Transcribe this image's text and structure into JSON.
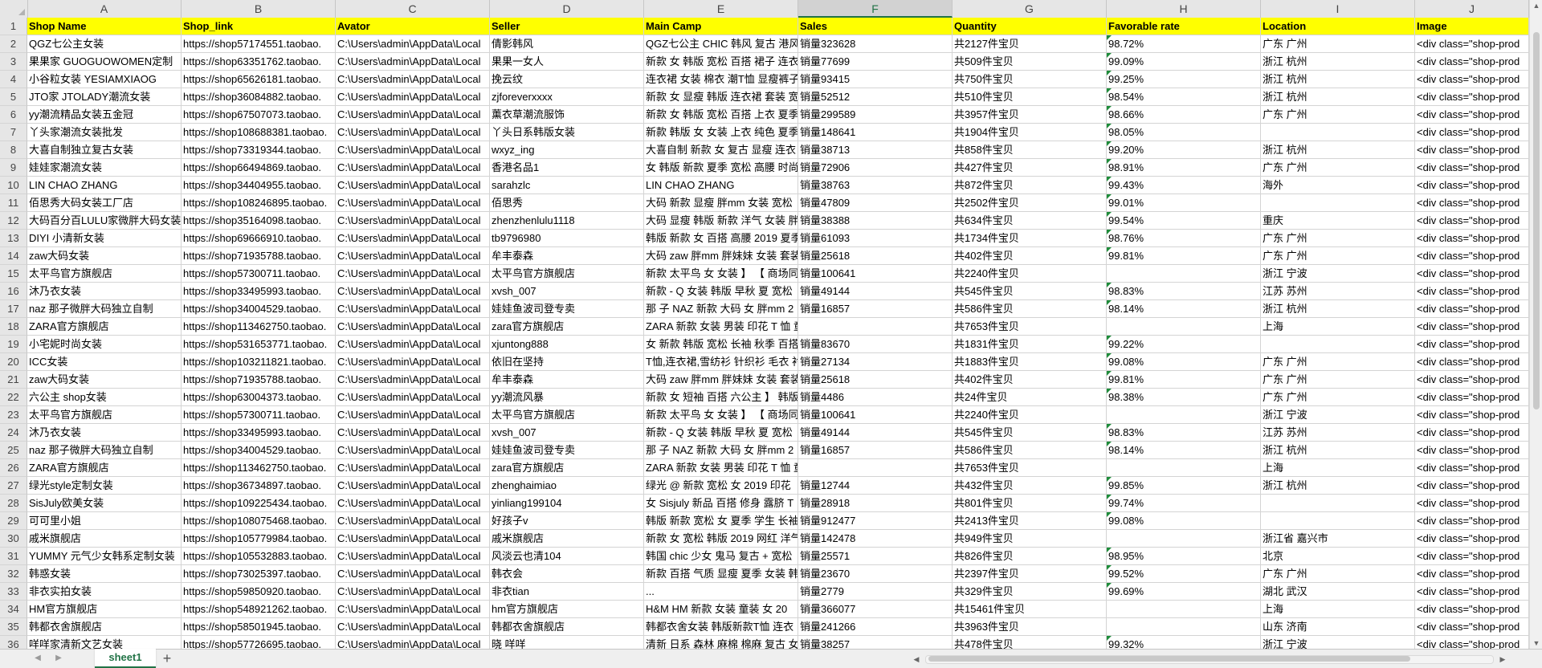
{
  "columns": [
    "A",
    "B",
    "C",
    "D",
    "E",
    "F",
    "G",
    "H",
    "I",
    "J"
  ],
  "selected_column": "F",
  "header_row": [
    "Shop Name",
    "Shop_link",
    "Avator",
    "Seller",
    "Main Camp",
    "Sales",
    "Quantity",
    "Favorable rate",
    "Location",
    "Image"
  ],
  "rows": [
    {
      "num": "2",
      "cells": [
        "QGZ七公主女装",
        "https://shop57174551.taobao.",
        "C:\\Users\\admin\\AppData\\Local",
        "倩影韩风",
        "QGZ七公主 CHIC 韩风 复古 港风",
        "销量323628",
        "共2127件宝贝",
        "98.72%",
        "广东 广州",
        "<div class=\"shop-prod"
      ],
      "flags": [
        false,
        false,
        false,
        false,
        false,
        false,
        false,
        true,
        false,
        false
      ]
    },
    {
      "num": "3",
      "cells": [
        "果果家  GUOGUOWOMEN定制",
        "https://shop63351762.taobao.",
        "C:\\Users\\admin\\AppData\\Local",
        "果果一女人",
        "新款 女 韩版 宽松 百搭 裙子 连衣",
        "销量77699",
        "共509件宝贝",
        "99.09%",
        "浙江 杭州",
        "<div class=\"shop-prod"
      ],
      "flags": [
        false,
        false,
        false,
        false,
        false,
        false,
        false,
        true,
        false,
        false
      ]
    },
    {
      "num": "4",
      "cells": [
        "小谷粒女装 YESIAMXIAOG",
        "https://shop65626181.taobao.",
        "C:\\Users\\admin\\AppData\\Local",
        "挽云纹",
        "连衣裙 女装 棉衣 潮T恤 显瘦裤子",
        "销量93415",
        "共750件宝贝",
        "99.25%",
        "浙江 杭州",
        "<div class=\"shop-prod"
      ],
      "flags": [
        false,
        false,
        false,
        false,
        false,
        false,
        false,
        true,
        false,
        false
      ]
    },
    {
      "num": "5",
      "cells": [
        "JTO家 JTOLADY潮流女装",
        "https://shop36084882.taobao.",
        "C:\\Users\\admin\\AppData\\Local",
        "zjforeverxxxx",
        "新款 女 显瘦 韩版 连衣裙 套装 宽",
        "销量52512",
        "共510件宝贝",
        "98.54%",
        "浙江 杭州",
        "<div class=\"shop-prod"
      ],
      "flags": [
        false,
        false,
        false,
        false,
        false,
        false,
        false,
        true,
        false,
        false
      ]
    },
    {
      "num": "6",
      "cells": [
        "yy潮流精品女装五金冠",
        "https://shop67507073.taobao.",
        "C:\\Users\\admin\\AppData\\Local",
        "薰衣草潮流服饰",
        "新款 女 韩版 宽松 百搭 上衣 夏季",
        "销量299589",
        "共3957件宝贝",
        "98.66%",
        "广东 广州",
        "<div class=\"shop-prod"
      ],
      "flags": [
        false,
        false,
        false,
        false,
        false,
        false,
        false,
        true,
        false,
        false
      ]
    },
    {
      "num": "7",
      "cells": [
        "丫头家潮流女装批发",
        "https://shop108688381.taobao.",
        "C:\\Users\\admin\\AppData\\Local",
        "丫头日系韩版女装",
        "新款 韩版 女 女装 上衣 纯色 夏季",
        "销量148641",
        "共1904件宝贝",
        "98.05%",
        "",
        "<div class=\"shop-prod"
      ],
      "flags": [
        false,
        false,
        false,
        false,
        false,
        false,
        false,
        true,
        false,
        false
      ]
    },
    {
      "num": "8",
      "cells": [
        "大喜自制独立复古女装",
        "https://shop73319344.taobao.",
        "C:\\Users\\admin\\AppData\\Local",
        "wxyz_ing",
        "大喜自制 新款 女 复古 显瘦 连衣",
        "销量38713",
        "共858件宝贝",
        "99.20%",
        "浙江 杭州",
        "<div class=\"shop-prod"
      ],
      "flags": [
        false,
        false,
        false,
        false,
        false,
        false,
        false,
        true,
        false,
        false
      ]
    },
    {
      "num": "9",
      "cells": [
        "娃娃家潮流女装",
        "https://shop66494869.taobao.",
        "C:\\Users\\admin\\AppData\\Local",
        "香港名品1",
        "女 韩版 新款 夏季 宽松 高腰 时尚",
        "销量72906",
        "共427件宝贝",
        "98.91%",
        "广东 广州",
        "<div class=\"shop-prod"
      ],
      "flags": [
        false,
        false,
        false,
        false,
        false,
        false,
        false,
        true,
        false,
        false
      ]
    },
    {
      "num": "10",
      "cells": [
        "LIN CHAO ZHANG",
        "https://shop34404955.taobao.",
        "C:\\Users\\admin\\AppData\\Local",
        "sarahzlc",
        "LIN CHAO ZHANG",
        "销量38763",
        "共872件宝贝",
        "99.43%",
        "海外",
        "<div class=\"shop-prod"
      ],
      "flags": [
        false,
        false,
        false,
        false,
        false,
        false,
        false,
        true,
        false,
        false
      ]
    },
    {
      "num": "11",
      "cells": [
        "佰思秀大码女装工厂店",
        "https://shop108246895.taobao.",
        "C:\\Users\\admin\\AppData\\Local",
        "佰思秀",
        "大码 新款 显瘦 胖mm 女装 宽松",
        "销量47809",
        "共2502件宝贝",
        "99.01%",
        "",
        "<div class=\"shop-prod"
      ],
      "flags": [
        false,
        false,
        false,
        false,
        false,
        false,
        false,
        true,
        false,
        false
      ]
    },
    {
      "num": "12",
      "cells": [
        "大码百分百LULU家微胖大码女装",
        "https://shop35164098.taobao.",
        "C:\\Users\\admin\\AppData\\Local",
        "zhenzhenlulu1118",
        "大码 显瘦 韩版 新款 洋气 女装 胖",
        "销量38388",
        "共634件宝贝",
        "99.54%",
        "重庆",
        "<div class=\"shop-prod"
      ],
      "flags": [
        false,
        false,
        false,
        false,
        false,
        false,
        false,
        true,
        false,
        false
      ]
    },
    {
      "num": "13",
      "cells": [
        "DIYI 小清新女装",
        "https://shop69666910.taobao.",
        "C:\\Users\\admin\\AppData\\Local",
        "tb9796980",
        "韩版 新款 女 百搭 高腰 2019 夏季",
        "销量61093",
        "共1734件宝贝",
        "98.76%",
        "广东 广州",
        "<div class=\"shop-prod"
      ],
      "flags": [
        false,
        false,
        false,
        false,
        false,
        false,
        false,
        true,
        false,
        false
      ]
    },
    {
      "num": "14",
      "cells": [
        "zaw大码女装",
        "https://shop71935788.taobao.",
        "C:\\Users\\admin\\AppData\\Local",
        "牟丰泰森",
        "大码 zaw 胖mm 胖妹妹 女装 套装",
        "销量25618",
        "共402件宝贝",
        "99.81%",
        "广东 广州",
        "<div class=\"shop-prod"
      ],
      "flags": [
        false,
        false,
        false,
        false,
        false,
        false,
        false,
        true,
        false,
        false
      ]
    },
    {
      "num": "15",
      "cells": [
        "太平鸟官方旗舰店",
        "https://shop57300711.taobao.",
        "C:\\Users\\admin\\AppData\\Local",
        "太平鸟官方旗舰店",
        "新款 太平鸟 女 女装 】 【 商场同",
        "销量100641",
        "共2240件宝贝",
        "",
        "浙江 宁波",
        "<div class=\"shop-prod"
      ],
      "flags": [
        false,
        false,
        false,
        false,
        false,
        false,
        false,
        false,
        false,
        false
      ]
    },
    {
      "num": "16",
      "cells": [
        "沐乃衣女装",
        "https://shop33495993.taobao.",
        "C:\\Users\\admin\\AppData\\Local",
        "xvsh_007",
        "新款 - Q 女装 韩版 早秋 夏 宽松",
        "销量49144",
        "共545件宝贝",
        "98.83%",
        "江苏 苏州",
        "<div class=\"shop-prod"
      ],
      "flags": [
        false,
        false,
        false,
        false,
        false,
        false,
        false,
        true,
        false,
        false
      ]
    },
    {
      "num": "17",
      "cells": [
        "naz 那子微胖大码独立自制",
        "https://shop34004529.taobao.",
        "C:\\Users\\admin\\AppData\\Local",
        "娃娃鱼波司登专卖",
        "那 子 NAZ 新款 大码 女 胖mm 2",
        "销量16857",
        "共586件宝贝",
        "98.14%",
        "浙江 杭州",
        "<div class=\"shop-prod"
      ],
      "flags": [
        false,
        false,
        false,
        false,
        false,
        false,
        false,
        true,
        false,
        false
      ]
    },
    {
      "num": "18",
      "cells": [
        "ZARA官方旗舰店",
        "https://shop113462750.taobao.",
        "C:\\Users\\admin\\AppData\\Local",
        "zara官方旗舰店",
        "ZARA 新款 女装 男装 印花 T 恤 童",
        "",
        "共7653件宝贝",
        "",
        "上海",
        "<div class=\"shop-prod"
      ],
      "flags": [
        false,
        false,
        false,
        false,
        false,
        false,
        false,
        false,
        false,
        false
      ]
    },
    {
      "num": "19",
      "cells": [
        "小宅妮时尚女装",
        "https://shop531653771.taobao.",
        "C:\\Users\\admin\\AppData\\Local",
        "xjuntong888",
        "女 新款 韩版 宽松 长袖 秋季 百搭",
        "销量83670",
        "共1831件宝贝",
        "99.22%",
        "",
        "<div class=\"shop-prod"
      ],
      "flags": [
        false,
        false,
        false,
        false,
        false,
        false,
        false,
        true,
        false,
        false
      ]
    },
    {
      "num": "20",
      "cells": [
        "ICC女装",
        "https://shop103211821.taobao.",
        "C:\\Users\\admin\\AppData\\Local",
        "依旧在坚持",
        "T恤,连衣裙,雪纺衫 针织衫 毛衣 衬",
        "销量27134",
        "共1883件宝贝",
        "99.08%",
        "广东 广州",
        "<div class=\"shop-prod"
      ],
      "flags": [
        false,
        false,
        false,
        false,
        false,
        false,
        false,
        true,
        false,
        false
      ]
    },
    {
      "num": "21",
      "cells": [
        "zaw大码女装",
        "https://shop71935788.taobao.",
        "C:\\Users\\admin\\AppData\\Local",
        "牟丰泰森",
        "大码 zaw 胖mm 胖妹妹 女装 套装",
        "销量25618",
        "共402件宝贝",
        "99.81%",
        "广东 广州",
        "<div class=\"shop-prod"
      ],
      "flags": [
        false,
        false,
        false,
        false,
        false,
        false,
        false,
        true,
        false,
        false
      ]
    },
    {
      "num": "22",
      "cells": [
        "六公主 shop女装",
        "https://shop63004373.taobao.",
        "C:\\Users\\admin\\AppData\\Local",
        "yy潮流风暴",
        "新款 女 短袖 百搭 六公主 】 韩版",
        "销量4486",
        "共24件宝贝",
        "98.38%",
        "广东 广州",
        "<div class=\"shop-prod"
      ],
      "flags": [
        false,
        false,
        false,
        false,
        false,
        false,
        false,
        true,
        false,
        false
      ]
    },
    {
      "num": "23",
      "cells": [
        "太平鸟官方旗舰店",
        "https://shop57300711.taobao.",
        "C:\\Users\\admin\\AppData\\Local",
        "太平鸟官方旗舰店",
        "新款 太平鸟 女 女装 】 【 商场同",
        "销量100641",
        "共2240件宝贝",
        "",
        "浙江 宁波",
        "<div class=\"shop-prod"
      ],
      "flags": [
        false,
        false,
        false,
        false,
        false,
        false,
        false,
        false,
        false,
        false
      ]
    },
    {
      "num": "24",
      "cells": [
        "沐乃衣女装",
        "https://shop33495993.taobao.",
        "C:\\Users\\admin\\AppData\\Local",
        "xvsh_007",
        "新款 - Q 女装 韩版 早秋 夏 宽松",
        "销量49144",
        "共545件宝贝",
        "98.83%",
        "江苏 苏州",
        "<div class=\"shop-prod"
      ],
      "flags": [
        false,
        false,
        false,
        false,
        false,
        false,
        false,
        true,
        false,
        false
      ]
    },
    {
      "num": "25",
      "cells": [
        "naz 那子微胖大码独立自制",
        "https://shop34004529.taobao.",
        "C:\\Users\\admin\\AppData\\Local",
        "娃娃鱼波司登专卖",
        "那 子 NAZ 新款 大码 女 胖mm 2",
        "销量16857",
        "共586件宝贝",
        "98.14%",
        "浙江 杭州",
        "<div class=\"shop-prod"
      ],
      "flags": [
        false,
        false,
        false,
        false,
        false,
        false,
        false,
        true,
        false,
        false
      ]
    },
    {
      "num": "26",
      "cells": [
        "ZARA官方旗舰店",
        "https://shop113462750.taobao.",
        "C:\\Users\\admin\\AppData\\Local",
        "zara官方旗舰店",
        "ZARA 新款 女装 男装 印花 T 恤 童",
        "",
        "共7653件宝贝",
        "",
        "上海",
        "<div class=\"shop-prod"
      ],
      "flags": [
        false,
        false,
        false,
        false,
        false,
        false,
        false,
        false,
        false,
        false
      ]
    },
    {
      "num": "27",
      "cells": [
        "绿光style定制女装",
        "https://shop36734897.taobao.",
        "C:\\Users\\admin\\AppData\\Local",
        "zhenghaimiao",
        "绿光 @ 新款 宽松 女 2019 印花",
        "销量12744",
        "共432件宝贝",
        "99.85%",
        "浙江 杭州",
        "<div class=\"shop-prod"
      ],
      "flags": [
        false,
        false,
        false,
        false,
        false,
        false,
        false,
        true,
        false,
        false
      ]
    },
    {
      "num": "28",
      "cells": [
        "SisJuly欧美女装",
        "https://shop109225434.taobao.",
        "C:\\Users\\admin\\AppData\\Local",
        "yinliang199104",
        "女 Sisjuly 新品 百搭 修身 露脐 T",
        "销量28918",
        "共801件宝贝",
        "99.74%",
        "",
        "<div class=\"shop-prod"
      ],
      "flags": [
        false,
        false,
        false,
        false,
        false,
        false,
        false,
        true,
        false,
        false
      ]
    },
    {
      "num": "29",
      "cells": [
        "可可里小姐",
        "https://shop108075468.taobao.",
        "C:\\Users\\admin\\AppData\\Local",
        "好孩子v",
        "韩版 新款 宽松 女 夏季 学生 长袖",
        "销量912477",
        "共2413件宝贝",
        "99.08%",
        "",
        "<div class=\"shop-prod"
      ],
      "flags": [
        false,
        false,
        false,
        false,
        false,
        false,
        false,
        true,
        false,
        false
      ]
    },
    {
      "num": "30",
      "cells": [
        "戚米旗舰店",
        "https://shop105779984.taobao.",
        "C:\\Users\\admin\\AppData\\Local",
        "戚米旗舰店",
        "新款 女 宽松 韩版 2019 网红 洋气",
        "销量142478",
        "共949件宝贝",
        "",
        "浙江省 嘉兴市",
        "<div class=\"shop-prod"
      ],
      "flags": [
        false,
        false,
        false,
        false,
        false,
        false,
        false,
        false,
        false,
        false
      ]
    },
    {
      "num": "31",
      "cells": [
        "YUMMY 元气少女韩系定制女装",
        "https://shop105532883.taobao.",
        "C:\\Users\\admin\\AppData\\Local",
        "风淡云也清104",
        "韩国 chic 少女 鬼马 复古 + 宽松",
        "销量25571",
        "共826件宝贝",
        "98.95%",
        "北京",
        "<div class=\"shop-prod"
      ],
      "flags": [
        false,
        false,
        false,
        false,
        false,
        false,
        false,
        true,
        false,
        false
      ]
    },
    {
      "num": "32",
      "cells": [
        "韩惑女装",
        "https://shop73025397.taobao.",
        "C:\\Users\\admin\\AppData\\Local",
        "韩衣会",
        "新款 百搭 气质 显瘦 夏季 女装 韩",
        "销量23670",
        "共2397件宝贝",
        "99.52%",
        "广东 广州",
        "<div class=\"shop-prod"
      ],
      "flags": [
        false,
        false,
        false,
        false,
        false,
        false,
        false,
        true,
        false,
        false
      ]
    },
    {
      "num": "33",
      "cells": [
        "非衣实拍女装",
        "https://shop59850920.taobao.",
        "C:\\Users\\admin\\AppData\\Local",
        "非衣tian",
        "...",
        "销量2779",
        "共329件宝贝",
        "99.69%",
        "湖北 武汉",
        "<div class=\"shop-prod"
      ],
      "flags": [
        false,
        false,
        false,
        false,
        false,
        false,
        false,
        true,
        false,
        false
      ]
    },
    {
      "num": "34",
      "cells": [
        "HM官方旗舰店",
        "https://shop548921262.taobao.",
        "C:\\Users\\admin\\AppData\\Local",
        "hm官方旗舰店",
        "H&M HM 新款 女装 童装 女 20",
        "销量366077",
        "共15461件宝贝",
        "",
        "上海",
        "<div class=\"shop-prod"
      ],
      "flags": [
        false,
        false,
        false,
        false,
        false,
        false,
        false,
        false,
        false,
        false
      ]
    },
    {
      "num": "35",
      "cells": [
        "韩都衣舍旗舰店",
        "https://shop58501945.taobao.",
        "C:\\Users\\admin\\AppData\\Local",
        "韩都衣舍旗舰店",
        "韩都衣舍女装 韩版新款T恤  连衣",
        "销量241266",
        "共3963件宝贝",
        "",
        "山东 济南",
        "<div class=\"shop-prod"
      ],
      "flags": [
        false,
        false,
        false,
        false,
        false,
        false,
        false,
        false,
        false,
        false
      ]
    },
    {
      "num": "36",
      "cells": [
        "咩咩家清新文艺女装",
        "https://shop57726695.taobao.",
        "C:\\Users\\admin\\AppData\\Local",
        "晓 咩咩",
        "清新 日系 森林 麻棉 棉麻 复古 女",
        "销量38257",
        "共478件宝贝",
        "99.32%",
        "浙江 宁波",
        "<div class=\"shop-prod"
      ],
      "flags": [
        false,
        false,
        false,
        false,
        false,
        false,
        false,
        true,
        false,
        false
      ]
    }
  ],
  "sheet_tab": "sheet1",
  "add_sheet_label": "+",
  "colors": {
    "header_fill": "#ffff00",
    "accent": "#217346",
    "flag": "#1e8c3a"
  }
}
